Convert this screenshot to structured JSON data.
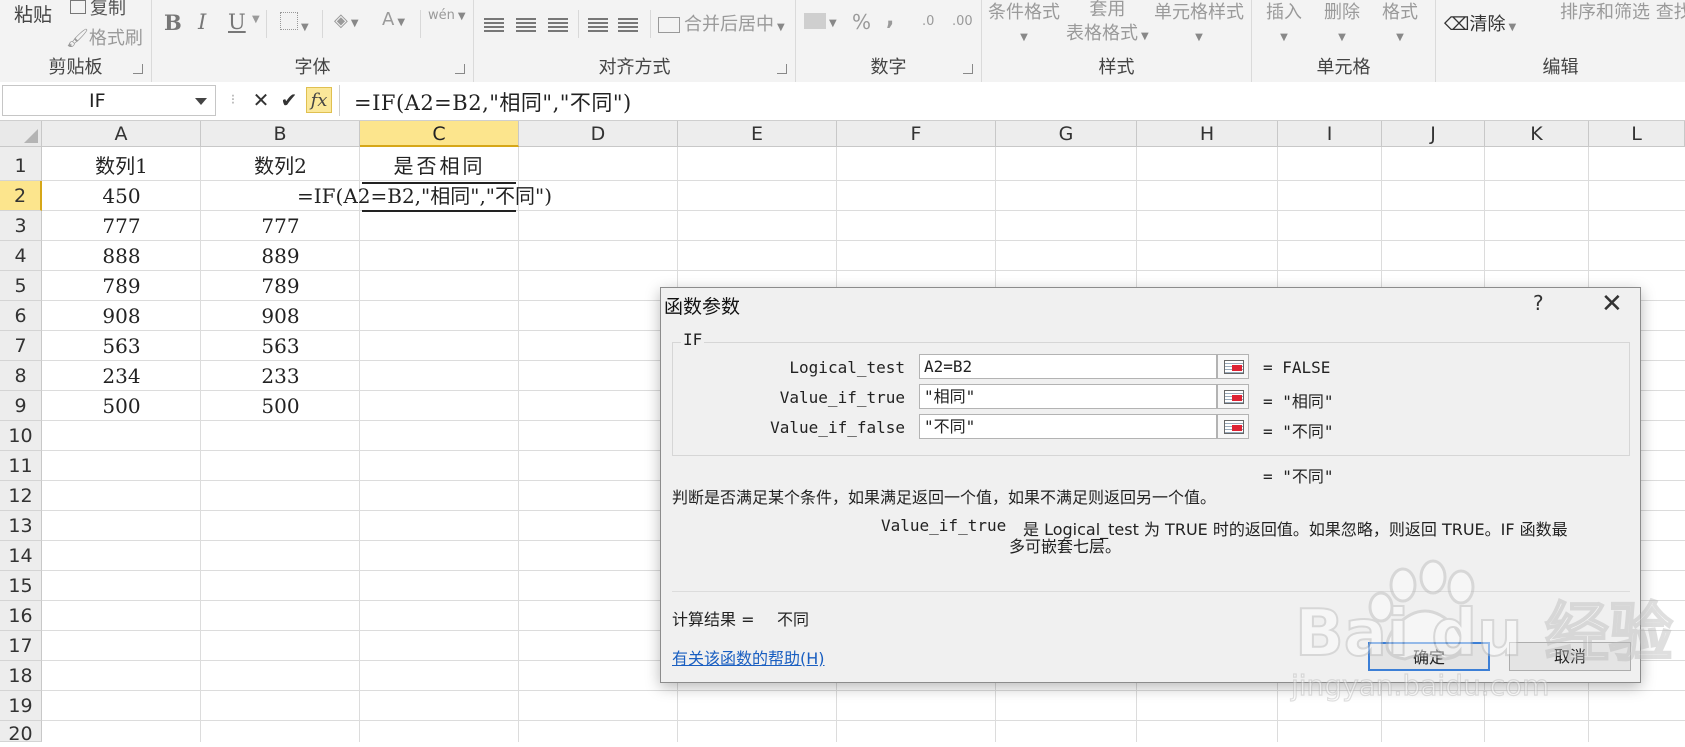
{
  "ribbon": {
    "clipboard": {
      "paste": "粘贴",
      "copy": "复制",
      "format_painter": "格式刷",
      "label": "剪贴板"
    },
    "font": {
      "bold": "B",
      "italic": "I",
      "underline": "U",
      "font_color": "A",
      "phonetic": "wén",
      "label": "字体"
    },
    "alignment": {
      "merge_center": "合并后居中",
      "label": "对齐方式"
    },
    "number": {
      "percent": "%",
      "comma": ",",
      "inc_decimal": ".0",
      "dec_decimal": ".00",
      "label": "数字"
    },
    "styles": {
      "conditional": "条件格式",
      "table_format_1": "套用",
      "table_format_2": "表格格式",
      "cell_styles": "单元格样式",
      "label": "样式"
    },
    "cells": {
      "insert": "插入",
      "delete": "删除",
      "format": "格式",
      "label": "单元格"
    },
    "editing": {
      "clear": "清除",
      "sort_filter": "排序和筛选 查找",
      "label": "编辑"
    }
  },
  "formula_bar": {
    "name_box": "IF",
    "cancel": "✕",
    "enter": "✔",
    "fx": "fx",
    "formula": "=IF(A2=B2,\"相同\",\"不同\")"
  },
  "columns": [
    "A",
    "B",
    "C",
    "D",
    "E",
    "F",
    "G",
    "H",
    "I",
    "J",
    "K",
    "L"
  ],
  "rows": [
    "1",
    "2",
    "3",
    "4",
    "5",
    "6",
    "7",
    "8",
    "9",
    "10",
    "11",
    "12",
    "13",
    "14",
    "15",
    "16",
    "17",
    "18",
    "19",
    "20"
  ],
  "cells": {
    "A1": "数列1",
    "B1": "数列2",
    "C1": "是否相同",
    "A2": "450",
    "B2_formula": "=IF(A2=B2,\"相同\",\"不同\")",
    "A3": "777",
    "B3": "777",
    "A4": "888",
    "B4": "889",
    "A5": "789",
    "B5": "789",
    "A6": "908",
    "B6": "908",
    "A7": "563",
    "B7": "563",
    "A8": "234",
    "B8": "233",
    "A9": "500",
    "B9": "500"
  },
  "dialog": {
    "title": "函数参数",
    "help": "?",
    "close": "✕",
    "function_name": "IF",
    "args": [
      {
        "label": "Logical_test",
        "value": "A2=B2",
        "result": "=  FALSE"
      },
      {
        "label": "Value_if_true",
        "value": "\"相同\"",
        "result": "=  \"相同\""
      },
      {
        "label": "Value_if_false",
        "value": "\"不同\"",
        "result": "=  \"不同\""
      }
    ],
    "overall_result": "=  \"不同\"",
    "description": "判断是否满足某个条件，如果满足返回一个值，如果不满足则返回另一个值。",
    "arg_help_name": "Value_if_true",
    "arg_help_line1": "是 Logical_test 为 TRUE 时的返回值。如果忽略，则返回 TRUE。IF 函数最",
    "arg_help_line2": "多可嵌套七层。",
    "calc_result_label": "计算结果 =",
    "calc_result_value": "不同",
    "help_link": "有关该函数的帮助(H)",
    "ok": "确定",
    "cancel": "取消"
  },
  "watermark": {
    "text": "Bai du 经验",
    "url": "jingyan.baidu.com"
  }
}
